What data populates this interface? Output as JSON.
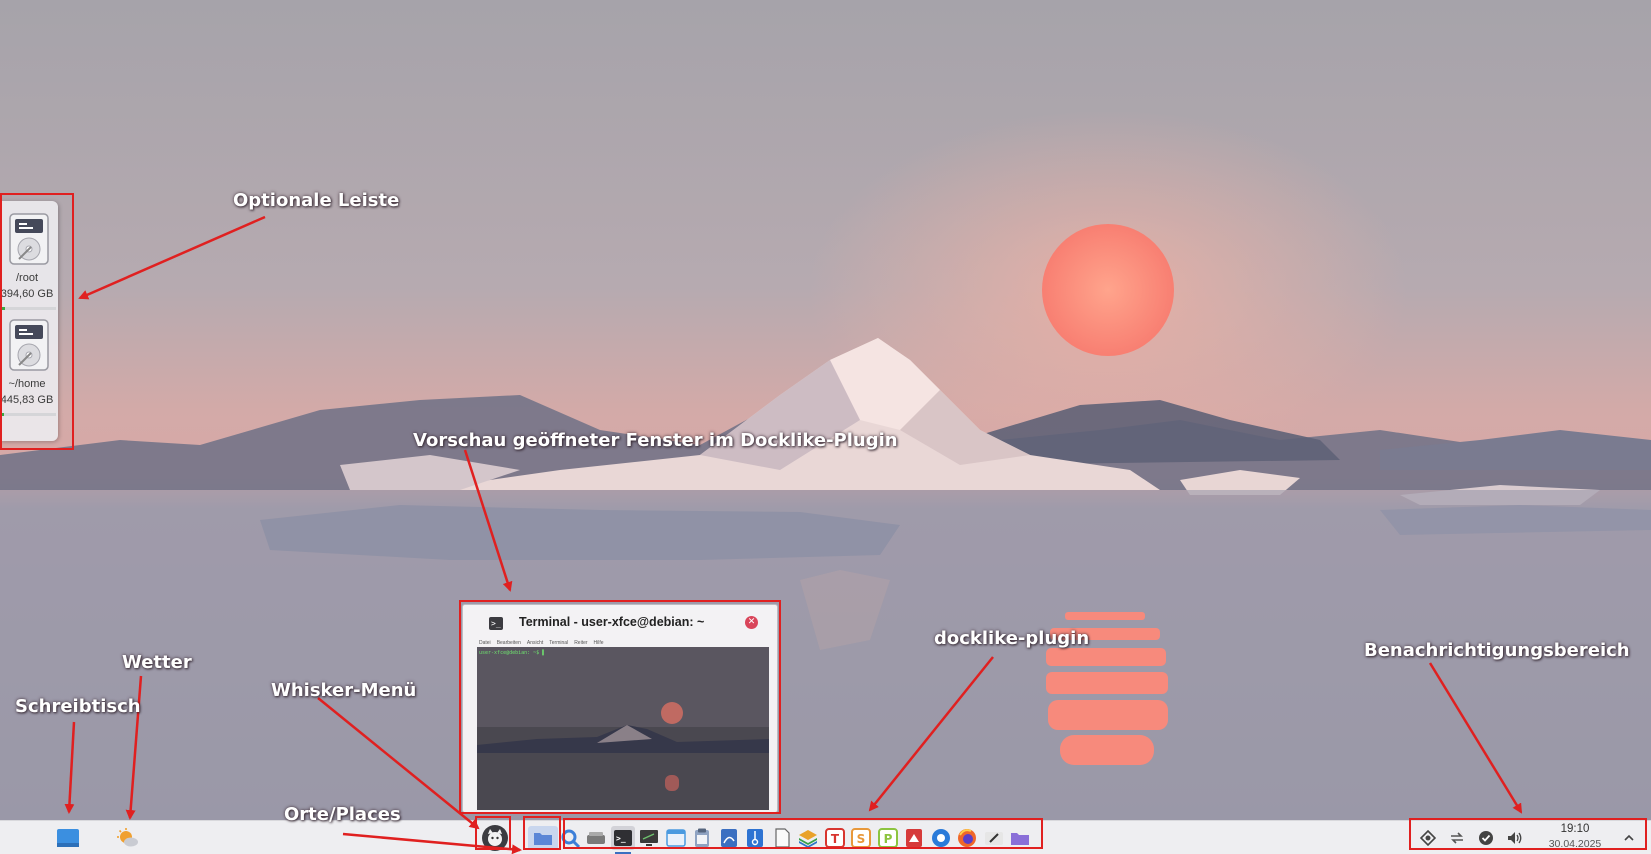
{
  "annotations": {
    "side_panel": "Optionale Leiste",
    "preview": "Vorschau geöffneter Fenster im Docklike-Plugin",
    "docklike": "docklike-plugin",
    "notification_area": "Benachrichtigungsbereich",
    "weather": "Wetter",
    "desktop": "Schreibtisch",
    "whisker": "Whisker-Menü",
    "places": "Orte/Places"
  },
  "side_panel": {
    "drives": [
      {
        "label": "/root",
        "size": "394,60 GB",
        "usage_fraction": 0.08
      },
      {
        "label": "~/home",
        "size": "445,83 GB",
        "usage_fraction": 0.04
      }
    ]
  },
  "preview": {
    "title": "Terminal - user-xfce@debian: ~",
    "menu": [
      "Datei",
      "Bearbeiten",
      "Ansicht",
      "Terminal",
      "Reiter",
      "Hilfe"
    ],
    "prompt": "user-xfce@debian: ~$ ▌"
  },
  "taskbar": {
    "left": [
      {
        "name": "show-desktop",
        "icon": "desktop-icon"
      },
      {
        "name": "weather",
        "icon": "weather-icon"
      }
    ],
    "whisker_icon": "whisker-menu-icon",
    "dock": [
      {
        "name": "places",
        "icon": "folder-icon",
        "color": "#5b86d6",
        "active": true
      },
      {
        "name": "search",
        "icon": "search-icon",
        "color": "#3d7fd8"
      },
      {
        "name": "disks",
        "icon": "drive-icon",
        "color": "#7a7a7a"
      },
      {
        "name": "terminal",
        "icon": "terminal-icon",
        "color": "#2f2f33",
        "open": true
      },
      {
        "name": "task-manager",
        "icon": "monitor-icon",
        "color": "#3a3a3a"
      },
      {
        "name": "window-app",
        "icon": "window-icon",
        "color": "#4a9ae0"
      },
      {
        "name": "clipboard",
        "icon": "clipboard-icon",
        "color": "#8fa3c2"
      },
      {
        "name": "document-viewer",
        "icon": "pdf-icon",
        "color": "#3b6fc1"
      },
      {
        "name": "archiver",
        "icon": "archive-icon",
        "color": "#2e73d2"
      },
      {
        "name": "text-file",
        "icon": "file-icon",
        "color": "#f4f4f4"
      },
      {
        "name": "layers",
        "icon": "layers-icon",
        "color": "#e9a22b"
      },
      {
        "name": "text-office",
        "icon": "text-icon",
        "color": "#d8352f",
        "letter": "T"
      },
      {
        "name": "spreadsheet",
        "icon": "sheet-icon",
        "color": "#e8983a",
        "letter": "S"
      },
      {
        "name": "presentation",
        "icon": "presentation-icon",
        "color": "#8cc43f",
        "letter": "P"
      },
      {
        "name": "pdf-reader",
        "icon": "pdf-reader-icon",
        "color": "#d63a3a"
      },
      {
        "name": "github",
        "icon": "github-icon",
        "color": "#2b7bd9"
      },
      {
        "name": "firefox",
        "icon": "firefox-icon",
        "color": "#f0672a"
      },
      {
        "name": "editor",
        "icon": "pen-icon",
        "color": "#e6e6e6"
      },
      {
        "name": "file-manager",
        "icon": "folder-icon",
        "color": "#8a6fd8"
      }
    ],
    "tray": [
      {
        "name": "network",
        "icon": "network-icon"
      },
      {
        "name": "transfer",
        "icon": "transfer-icon"
      },
      {
        "name": "updates",
        "icon": "check-icon"
      },
      {
        "name": "volume",
        "icon": "volume-icon"
      }
    ],
    "clock": {
      "time": "19:10",
      "date": "30.04.2025"
    },
    "expand_icon": "chevron-up-icon"
  }
}
